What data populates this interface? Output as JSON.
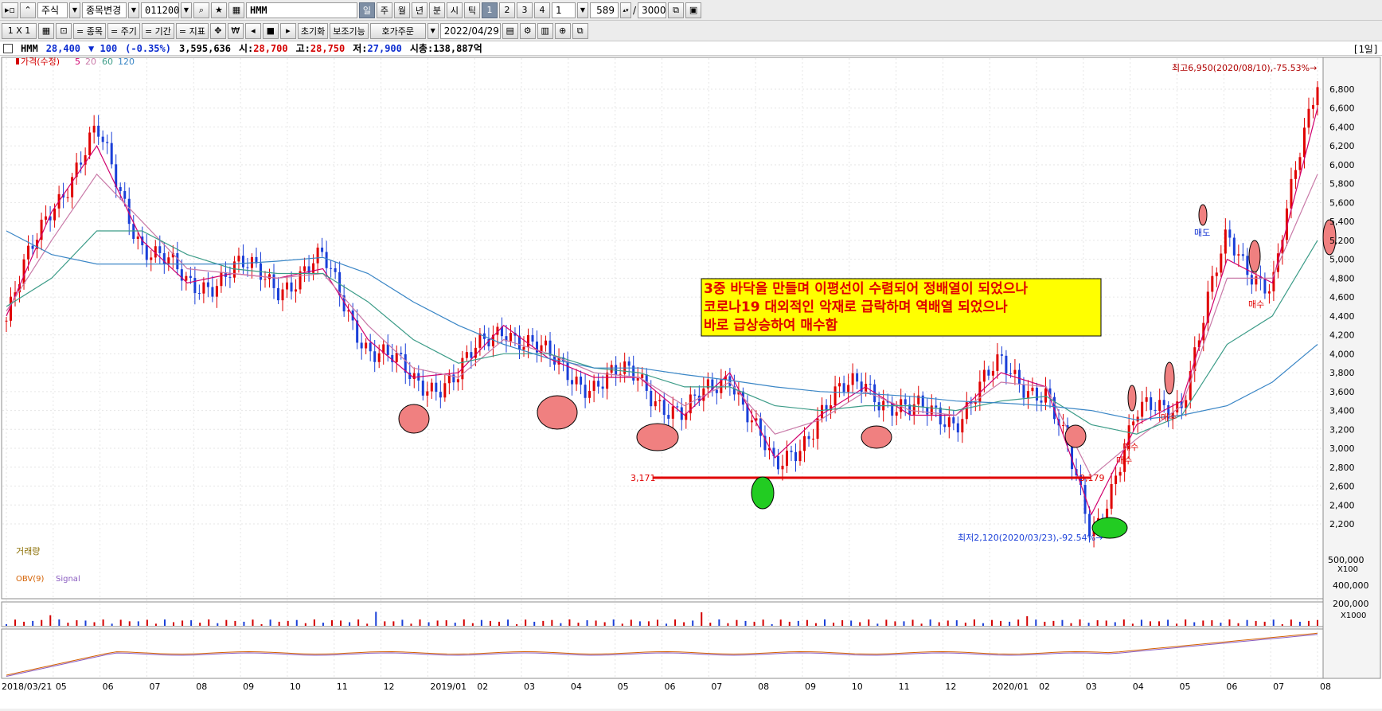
{
  "toolbar1": {
    "market": "주식",
    "change_label": "종목변경",
    "code": "011200",
    "name": "HMM",
    "periods": [
      "일",
      "주",
      "월",
      "년",
      "분",
      "시",
      "틱"
    ],
    "units": [
      "1",
      "2",
      "3",
      "4"
    ],
    "unit_value": "1",
    "count": "589",
    "slash": "/",
    "max_count": "3000"
  },
  "toolbar2": {
    "layout": "1 X 1",
    "item_label": "= 종목",
    "cycle_label": "= 주기",
    "period_label": "= 기간",
    "indicator_label": "= 지표",
    "won": "₩",
    "reset_label": "초기화",
    "assist_label": "보조기능",
    "order_label": "호가주문",
    "date": "2022/04/29"
  },
  "info": {
    "name": "HMM",
    "price": "28,400",
    "change": "▼ 100",
    "pct": "(-0.35%)",
    "volume": "3,595,636",
    "open_label": "시:",
    "open": "28,700",
    "high_label": "고:",
    "high": "28,750",
    "low_label": "저:",
    "low": "27,900",
    "cap_label": "시총:",
    "cap": "138,887억",
    "period": "[1일]"
  },
  "legend": {
    "price": "가격(수정)",
    "ma5": "5",
    "ma20": "20",
    "ma60": "60",
    "ma120": "120",
    "volume": "거래량",
    "obv": "OBV(9)",
    "signal": "Signal"
  },
  "colors": {
    "candle_up": "#e00000",
    "candle_down": "#1a3fd8",
    "ma5": "#d1006e",
    "ma20": "#c97aa8",
    "ma60": "#3c9c88",
    "ma120": "#3a86c6",
    "annotation": "#e00000",
    "note_bg": "#ffff00"
  },
  "annotations": {
    "high": "최고6,950(2020/08/10),-75.53%→",
    "low": "최저2,120(2020/03/23),-92.54%→",
    "level_left": "3,171",
    "level_right": "3,179",
    "note_lines": [
      "3중 바닥을 만들며 이평선이 수렴되어 정배열이 되었으나",
      "코로나19 대외적인 악재로 급락하며 역배열 되었으나",
      "바로 급상승하여 매수함"
    ],
    "buy": "매수",
    "sell": "매도"
  },
  "price_axis": [
    "6,800",
    "6,600",
    "6,400",
    "6,200",
    "6,000",
    "5,800",
    "5,600",
    "5,400",
    "5,200",
    "5,000",
    "4,800",
    "4,600",
    "4,400",
    "4,200",
    "4,000",
    "3,800",
    "3,600",
    "3,400",
    "3,200",
    "3,000",
    "2,800",
    "2,600",
    "2,400",
    "2,200"
  ],
  "volume_axis": {
    "tick": "500,000",
    "unit": "X100"
  },
  "obv_axis": {
    "ticks": [
      "400,000",
      "200,000"
    ],
    "unit": "X1000"
  },
  "date_axis": [
    "2018/03/21",
    "05",
    "06",
    "07",
    "08",
    "09",
    "10",
    "11",
    "12",
    "2019/01",
    "02",
    "03",
    "04",
    "05",
    "06",
    "07",
    "08",
    "09",
    "10",
    "11",
    "12",
    "2020/01",
    "02",
    "03",
    "04",
    "05",
    "06",
    "07",
    "08"
  ],
  "chart_data": {
    "type": "line",
    "title": "",
    "x": [
      "2018/03",
      "2018/04",
      "2018/05",
      "2018/06",
      "2018/07",
      "2018/08",
      "2018/09",
      "2018/10",
      "2018/11",
      "2018/12",
      "2019/01",
      "2019/02",
      "2019/03",
      "2019/04",
      "2019/05",
      "2019/06",
      "2019/07",
      "2019/08",
      "2019/09",
      "2019/10",
      "2019/11",
      "2019/12",
      "2020/01",
      "2020/02",
      "2020/03",
      "2020/04",
      "2020/05",
      "2020/06",
      "2020/07",
      "2020/08"
    ],
    "series": [
      {
        "name": "가격(수정)",
        "values": [
          4350,
          5600,
          6300,
          5200,
          4700,
          4900,
          4750,
          4950,
          4100,
          3700,
          3750,
          4350,
          3900,
          3700,
          3750,
          3300,
          3850,
          2700,
          3400,
          3700,
          3350,
          3350,
          3850,
          3600,
          2120,
          3300,
          3550,
          5200,
          4700,
          6950
        ]
      },
      {
        "name": "5",
        "values": [
          4400,
          5500,
          6200,
          5200,
          4750,
          4850,
          4800,
          4900,
          4150,
          3750,
          3800,
          4300,
          3950,
          3750,
          3750,
          3350,
          3800,
          2900,
          3350,
          3650,
          3350,
          3350,
          3800,
          3650,
          2300,
          3250,
          3500,
          5000,
          4750,
          6600
        ]
      },
      {
        "name": "20",
        "values": [
          4450,
          5200,
          5900,
          5400,
          4900,
          4850,
          4800,
          4850,
          4300,
          3850,
          3750,
          4150,
          4000,
          3800,
          3750,
          3450,
          3700,
          3150,
          3300,
          3600,
          3400,
          3350,
          3700,
          3650,
          2700,
          3100,
          3450,
          4800,
          4800,
          5900
        ]
      },
      {
        "name": "60",
        "values": [
          4500,
          4800,
          5300,
          5300,
          5050,
          4900,
          4850,
          4850,
          4550,
          4150,
          3900,
          4000,
          4000,
          3850,
          3800,
          3650,
          3650,
          3450,
          3400,
          3450,
          3450,
          3400,
          3500,
          3550,
          3250,
          3150,
          3350,
          4100,
          4400,
          5200
        ]
      },
      {
        "name": "120",
        "values": [
          5300,
          5050,
          4950,
          4950,
          4950,
          4950,
          4980,
          5020,
          4850,
          4550,
          4300,
          4100,
          3950,
          3850,
          3850,
          3780,
          3720,
          3650,
          3600,
          3580,
          3550,
          3500,
          3480,
          3450,
          3400,
          3300,
          3350,
          3450,
          3700,
          4100
        ]
      }
    ],
    "ylim": [
      2100,
      7000
    ],
    "grid": true
  }
}
